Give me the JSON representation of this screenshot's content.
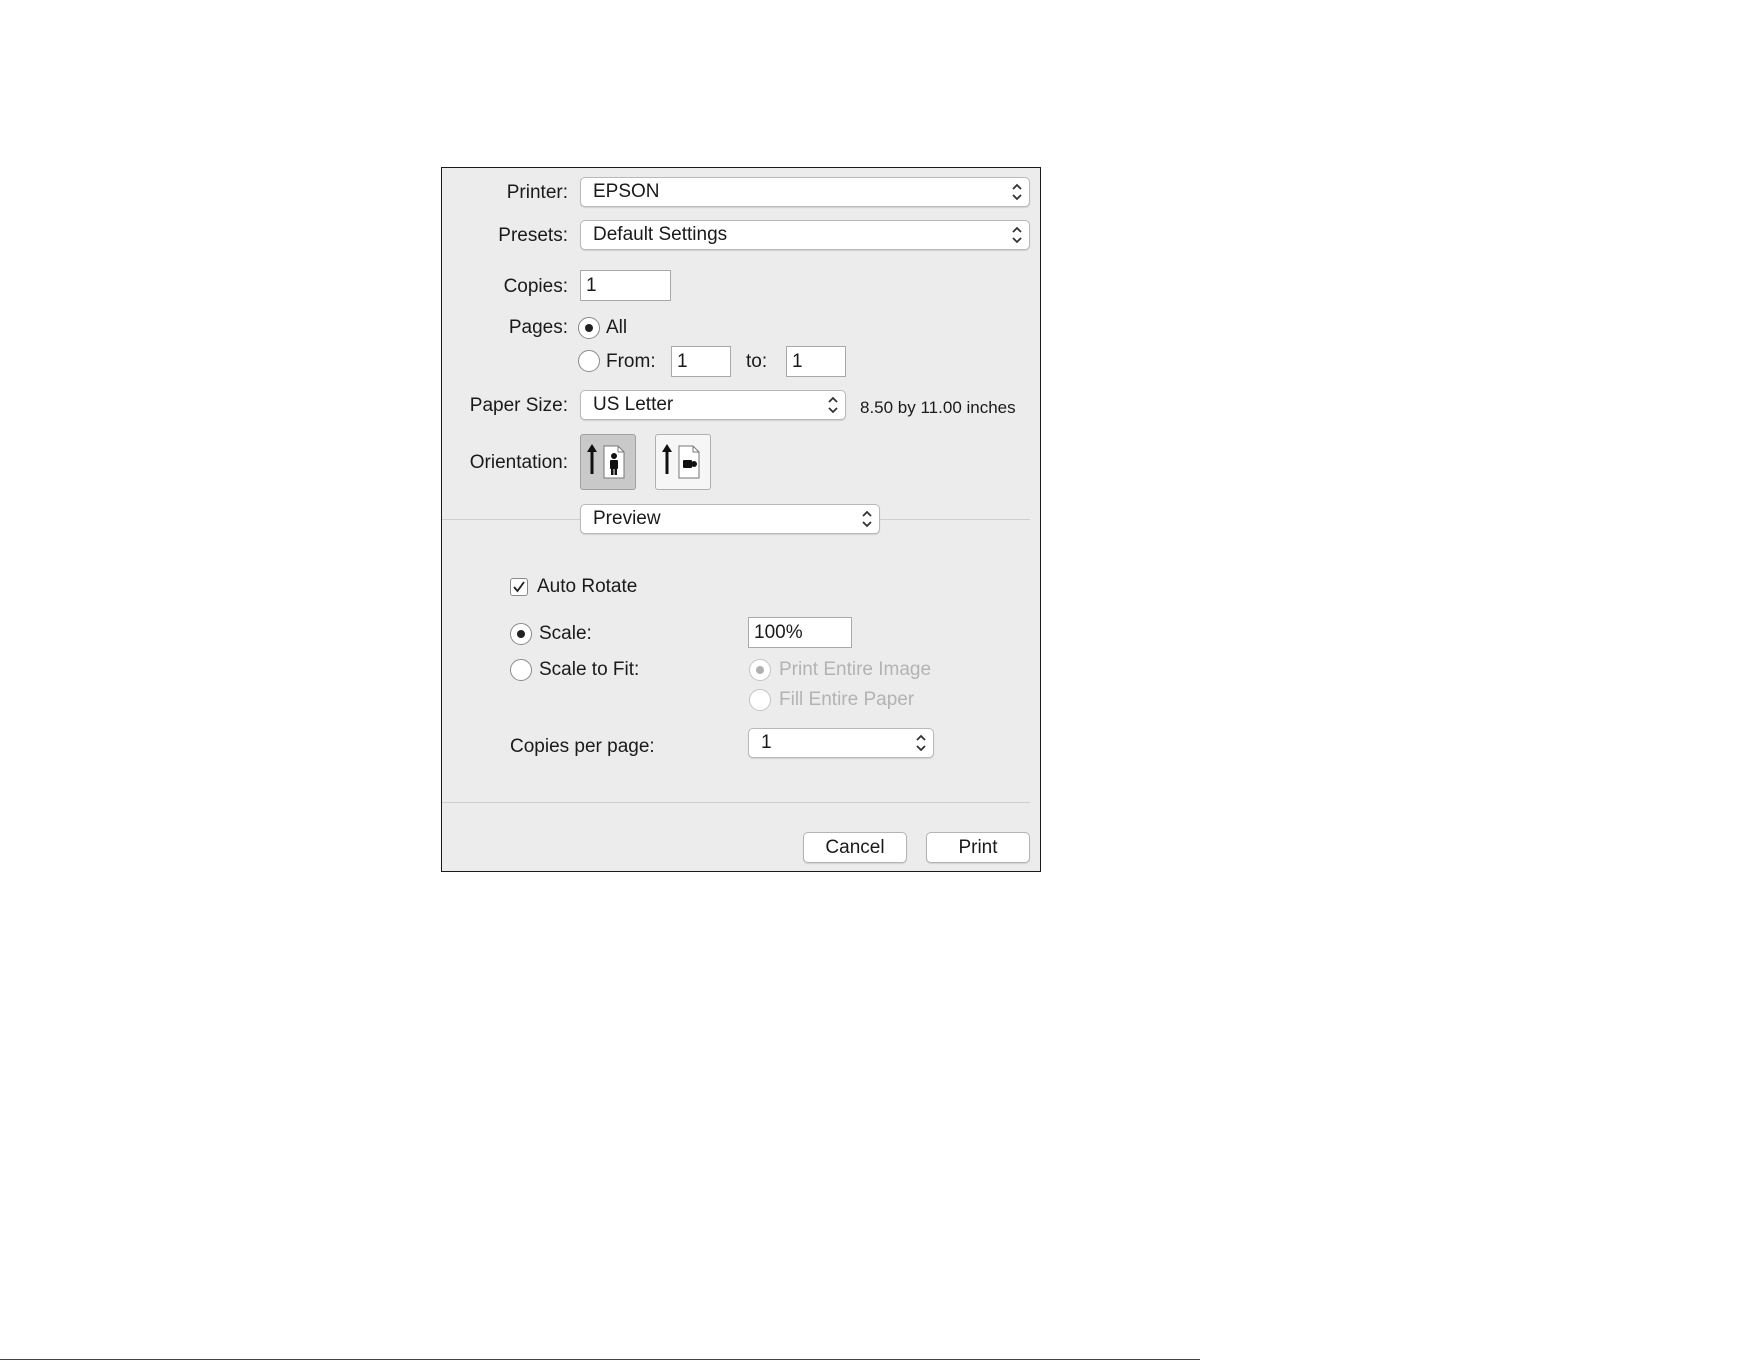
{
  "printer": {
    "label": "Printer:",
    "value": "EPSON"
  },
  "presets": {
    "label": "Presets:",
    "value": "Default Settings"
  },
  "copies": {
    "label": "Copies:",
    "value": "1"
  },
  "pages": {
    "label": "Pages:",
    "all_label": "All",
    "from_label": "From:",
    "from_value": "1",
    "to_label": "to:",
    "to_value": "1",
    "selected": "all"
  },
  "paper_size": {
    "label": "Paper Size:",
    "value": "US Letter",
    "dimensions": "8.50 by 11.00 inches"
  },
  "orientation": {
    "label": "Orientation:",
    "selected": "portrait",
    "options": [
      "portrait-icon",
      "landscape-icon"
    ]
  },
  "section": {
    "value": "Preview"
  },
  "preview": {
    "auto_rotate_label": "Auto Rotate",
    "auto_rotate_checked": true,
    "scale_label": "Scale:",
    "scale_value": "100%",
    "scale_to_fit_label": "Scale to Fit:",
    "print_entire_image_label": "Print Entire Image",
    "fill_entire_paper_label": "Fill Entire Paper",
    "copies_per_page_label": "Copies per page:",
    "copies_per_page_value": "1"
  },
  "buttons": {
    "cancel": "Cancel",
    "print": "Print"
  }
}
